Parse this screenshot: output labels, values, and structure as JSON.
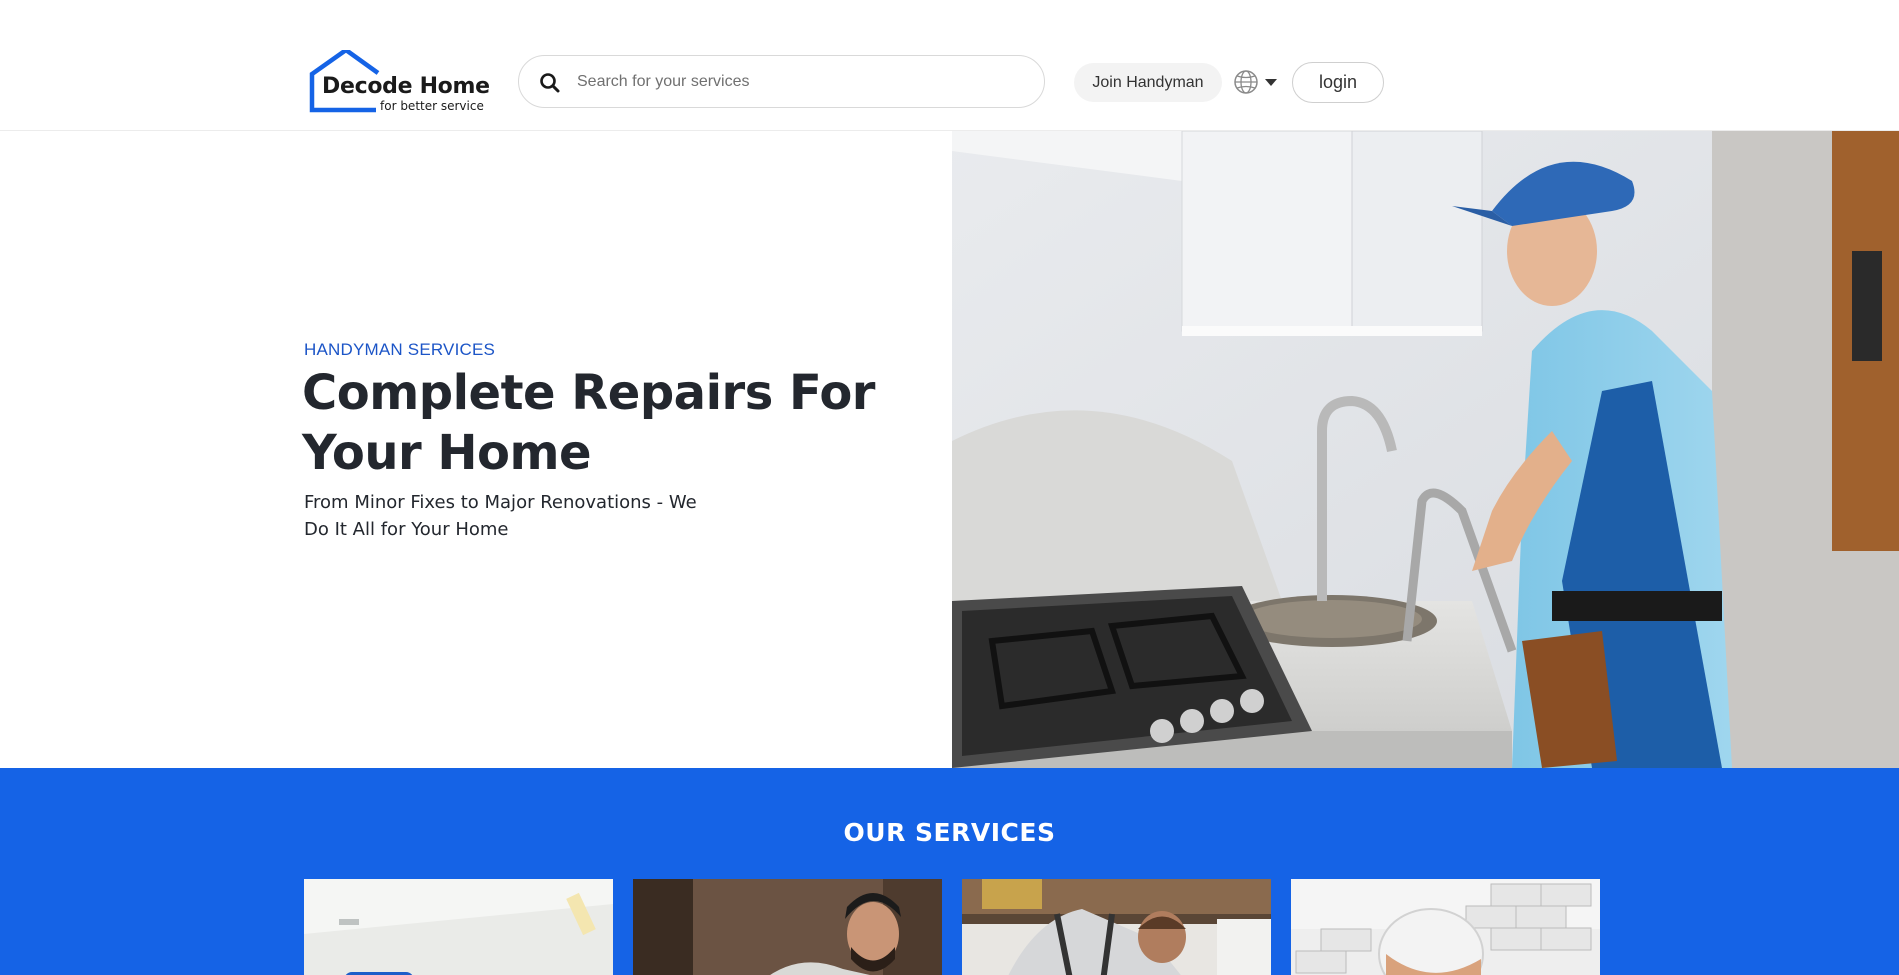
{
  "brand": {
    "name": "Decode Home",
    "tagline": "for better service",
    "logo_color": "#1563e6"
  },
  "header": {
    "search": {
      "placeholder": "Search for your services",
      "value": ""
    },
    "join_label": "Join Handyman",
    "language_icon": "globe-icon",
    "login_label": "login"
  },
  "hero": {
    "eyebrow": "HANDYMAN SERVICES",
    "title": "Complete Repairs For Your Home",
    "subtitle": "From Minor Fixes to Major Renovations - We Do It All for Your Home",
    "image": "handyman-kitchen-faucet-photo"
  },
  "services": {
    "title": "OUR SERVICES",
    "background": "#1563e6",
    "cards": [
      {
        "image": "wall-painting-photo"
      },
      {
        "image": "carpenter-woodwork-photo"
      },
      {
        "image": "plumber-under-sink-photo"
      },
      {
        "image": "tile-worker-helmet-photo"
      }
    ]
  }
}
